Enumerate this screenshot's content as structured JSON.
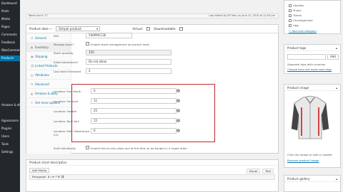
{
  "sidebar": {
    "items": [
      "Dashboard",
      "Posts",
      "Media",
      "Pages",
      "Comments",
      "Feedback",
      "WooCommerce",
      "Products",
      "",
      "",
      "",
      "",
      "",
      "Amazon & eBay",
      "",
      "Appearance",
      "Plugins",
      "Users",
      "Tools",
      "Settings",
      "",
      ""
    ]
  },
  "word_count": {
    "left": "Word count: 17",
    "right": "Last edited by NT Man on June 13, 2019 at 12:54 pm"
  },
  "product_data": {
    "title": "Product data —",
    "type_select": "Simple product",
    "virtual_label": "Virtual:",
    "downloadable_label": "Downloadable:",
    "tabs": [
      "General",
      "Inventory",
      "Shipping",
      "Linked Products",
      "Attributes",
      "Advanced",
      "Amazon & eBay",
      "Get more options"
    ],
    "active_tab": 1
  },
  "inventory": {
    "sku_label": "SKU",
    "sku_value": "5X6PMCC3E",
    "manage_label": "Manage stock?",
    "manage_text": "Enable stock management at product level",
    "qty_label": "Stock quantity",
    "qty_value": "150",
    "backorders_label": "Allow backorders?",
    "backorders_value": "Do not allow",
    "threshold_label": "Low stock threshold",
    "threshold_value": "2",
    "locations": [
      {
        "label": "Location: Fort Worth",
        "value": "0"
      },
      {
        "label": "Location: Portland",
        "value": "11"
      },
      {
        "label": "Location: Seattle",
        "value": "25"
      },
      {
        "label": "Location: New York",
        "value": "15"
      },
      {
        "label": "Location: Main Warehouse",
        "value": "0"
      }
    ],
    "location_suffix": "ICU",
    "sold_label": "Sold individually",
    "sold_text": "Enable this to only allow one of this item to be bought in a single order"
  },
  "description": {
    "title": "Product short description",
    "add_media": "Add Media",
    "visual_tab": "Visual",
    "text_tab": "Text",
    "toolbar_text": "Paragraph"
  },
  "categories": {
    "items": [
      "Hoodies",
      "Shoes",
      "Tshirts",
      "Uncategorized",
      "Ugg"
    ],
    "add_link": "+ Add new category"
  },
  "tags": {
    "title": "Product tags",
    "add_button": "Add",
    "help": "Separate tags with commas",
    "choose_link": "Choose from the most used tags"
  },
  "image": {
    "title": "Product image",
    "edit_help": "Click the image to edit or update",
    "remove_link": "Remove product image"
  },
  "gallery": {
    "title": "Product gallery"
  }
}
